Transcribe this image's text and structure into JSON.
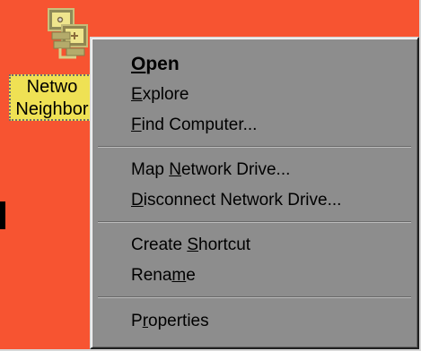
{
  "desktop": {
    "background_color": "#f75431",
    "icon": {
      "label_line_1": "Netwo",
      "label_line_2": "Neighbor",
      "icon_name": "network-neighborhood-icon"
    }
  },
  "context_menu": {
    "items": [
      {
        "label": "Open",
        "style": "bold"
      },
      {
        "label": "Explore"
      },
      {
        "label": "Find Computer..."
      },
      {
        "label": "Map Network Drive..."
      },
      {
        "label": "Disconnect Network Drive..."
      },
      {
        "label": "Create Shortcut"
      },
      {
        "label": "Rename"
      },
      {
        "label": "Properties"
      }
    ]
  }
}
